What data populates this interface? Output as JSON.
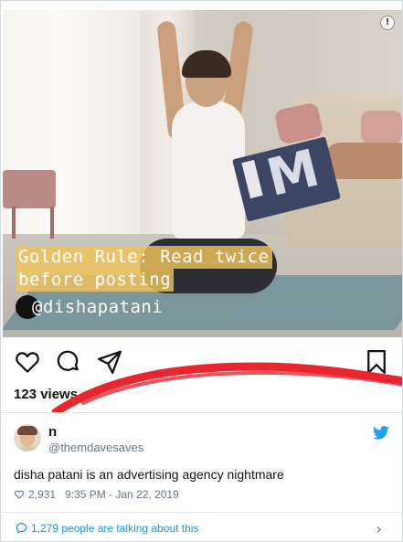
{
  "post": {
    "caption_line1": "Golden Rule: Read twice",
    "caption_line2": "before posting",
    "mention": "@dishapatani",
    "views": "123 views",
    "info_icon": "!"
  },
  "tweet": {
    "name": "n",
    "handle": "@themdavesaves",
    "text": "disha patani is an advertising agency nightmare",
    "likes": "2,931",
    "time": "9:35 PM - Jan 22, 2019",
    "talking": "1,279 people are talking about this",
    "chevron": "›"
  },
  "colors": {
    "caption_highlight": "#f0c35a",
    "annotation_red": "#e8262f",
    "twitter_blue": "#1da1f2",
    "link_blue": "#1b95e0"
  },
  "icons": {
    "heart": "heart-icon",
    "comment": "comment-icon",
    "share": "share-icon",
    "bookmark": "bookmark-icon",
    "twitter": "twitter-bird-icon",
    "info": "info-icon",
    "chevron": "chevron-right-icon"
  }
}
